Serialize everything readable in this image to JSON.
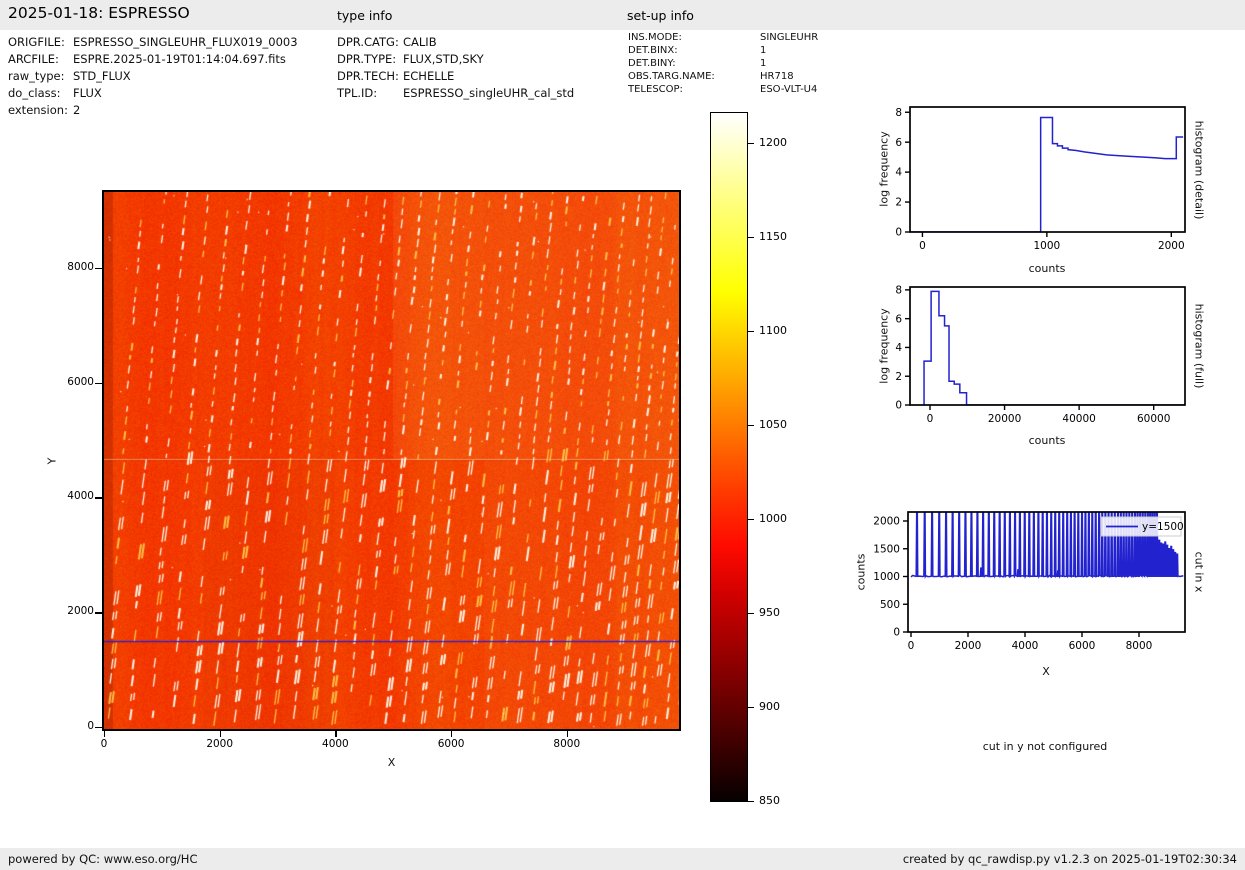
{
  "header": {
    "title": "2025-01-18: ESPRESSO",
    "type_info_label": "type info",
    "setup_info_label": "set-up info"
  },
  "file_info": {
    "rows": [
      {
        "label": "ORIGFILE:",
        "value": "ESPRESSO_SINGLEUHR_FLUX019_0003"
      },
      {
        "label": "ARCFILE:",
        "value": "ESPRE.2025-01-19T01:14:04.697.fits"
      },
      {
        "label": "raw_type:",
        "value": "STD_FLUX"
      },
      {
        "label": "do_class:",
        "value": "FLUX"
      },
      {
        "label": "extension:",
        "value": "2"
      }
    ]
  },
  "type_info": {
    "rows": [
      {
        "label": "DPR.CATG:",
        "value": "CALIB"
      },
      {
        "label": "DPR.TYPE:",
        "value": "FLUX,STD,SKY"
      },
      {
        "label": "DPR.TECH:",
        "value": "ECHELLE"
      },
      {
        "label": "TPL.ID:",
        "value": "ESPRESSO_singleUHR_cal_std"
      }
    ]
  },
  "setup_info": {
    "rows": [
      {
        "label": "INS.MODE:",
        "value": "SINGLEUHR"
      },
      {
        "label": "DET.BINX:",
        "value": "1"
      },
      {
        "label": "DET.BINY:",
        "value": "1"
      },
      {
        "label": "OBS.TARG.NAME:",
        "value": "HR718"
      },
      {
        "label": "TELESCOP:",
        "value": "ESO-VLT-U4"
      }
    ]
  },
  "footer": {
    "left": "powered by QC: www.eso.org/HC",
    "right": "created by qc_rawdisp.py v1.2.3 on 2025-01-19T02:30:34"
  },
  "colors": {
    "accent_blue": "#2222cf",
    "frame_black": "#000000",
    "bar_gray": "#ececec",
    "hot_background_orange": "#f84c04"
  },
  "chart_data": [
    {
      "id": "raw_frame",
      "type": "heatmap",
      "xlabel": "X",
      "ylabel": "Y",
      "xlim": [
        0,
        9900
      ],
      "ylim": [
        0,
        9350
      ],
      "x_ticks": [
        0,
        2000,
        4000,
        6000,
        8000
      ],
      "y_ticks": [
        0,
        2000,
        4000,
        6000,
        8000
      ],
      "colormap": "hot",
      "vmin": 850,
      "vmax": 1216,
      "background_level": 1020,
      "trace_level": 1216,
      "n_order_traces": 35,
      "detector_seam_y": 4650,
      "cut_line": {
        "y": 1500,
        "color": "#2222cf"
      },
      "description": "Raw ESPRESSO echelle frame: orange noisy background near 1000 counts crossed by ~35 near-vertical dashed bright order traces, detector seam at y=4650, blue cut line at y=1500"
    },
    {
      "id": "colorbar",
      "type": "colorbar",
      "orientation": "vertical",
      "colormap": "hot",
      "vmin": 850,
      "vmax": 1216,
      "ticks": [
        1200,
        1150,
        1100,
        1050,
        1000,
        950,
        900,
        850
      ]
    },
    {
      "id": "histogram_detail",
      "type": "line",
      "right_label": "histogram (detail)",
      "xlabel": "counts",
      "ylabel": "log frequency",
      "xlim": [
        -100,
        2110
      ],
      "ylim": [
        0,
        8.35
      ],
      "x_ticks": [
        0,
        1000,
        2000
      ],
      "y_ticks": [
        0,
        2,
        4,
        6,
        8
      ],
      "line_color": "#2222cf",
      "points": [
        [
          -90,
          0
        ],
        [
          950,
          0
        ],
        [
          950,
          7.65
        ],
        [
          1045,
          7.65
        ],
        [
          1045,
          5.9
        ],
        [
          1085,
          5.9
        ],
        [
          1085,
          5.75
        ],
        [
          1125,
          5.75
        ],
        [
          1125,
          5.6
        ],
        [
          1170,
          5.6
        ],
        [
          1170,
          5.5
        ],
        [
          1230,
          5.45
        ],
        [
          1300,
          5.35
        ],
        [
          1390,
          5.25
        ],
        [
          1480,
          5.15
        ],
        [
          1570,
          5.1
        ],
        [
          1670,
          5.05
        ],
        [
          1780,
          5.0
        ],
        [
          1880,
          4.95
        ],
        [
          1950,
          4.9
        ],
        [
          2040,
          4.9
        ],
        [
          2040,
          6.35
        ],
        [
          2095,
          6.35
        ]
      ]
    },
    {
      "id": "histogram_full",
      "type": "line",
      "right_label": "histogram (full)",
      "xlabel": "counts",
      "ylabel": "log frequency",
      "xlim": [
        -5365,
        68400
      ],
      "ylim": [
        0,
        8.2
      ],
      "x_ticks": [
        0,
        20000,
        40000,
        60000
      ],
      "y_ticks": [
        0,
        2,
        4,
        6,
        8
      ],
      "line_color": "#2222cf",
      "points": [
        [
          -1600,
          0
        ],
        [
          -1600,
          3.05
        ],
        [
          300,
          3.05
        ],
        [
          300,
          7.9
        ],
        [
          2400,
          7.9
        ],
        [
          2400,
          6.2
        ],
        [
          3900,
          6.2
        ],
        [
          3900,
          5.5
        ],
        [
          5100,
          5.5
        ],
        [
          5100,
          1.65
        ],
        [
          6500,
          1.65
        ],
        [
          6500,
          1.45
        ],
        [
          8000,
          1.45
        ],
        [
          8000,
          0.85
        ],
        [
          9800,
          0.85
        ],
        [
          9800,
          0
        ],
        [
          68400,
          0
        ]
      ]
    },
    {
      "id": "cut_in_x",
      "type": "line",
      "right_label": "cut in x",
      "xlabel": "X",
      "ylabel": "counts",
      "legend": {
        "label": "y=1500",
        "color": "#2222cf",
        "position": "upper right"
      },
      "xlim": [
        -105,
        9614
      ],
      "ylim": [
        0,
        2162
      ],
      "x_ticks": [
        0,
        2000,
        4000,
        6000,
        8000
      ],
      "y_ticks": [
        0,
        500,
        1000,
        1500,
        2000
      ],
      "baseline": 1000,
      "line_color": "#2222cf",
      "spikes": [
        [
          200,
          2162
        ],
        [
          470,
          2162
        ],
        [
          730,
          2162
        ],
        [
          980,
          2162
        ],
        [
          1220,
          2162
        ],
        [
          1450,
          2162
        ],
        [
          1680,
          2162
        ],
        [
          1900,
          2162
        ],
        [
          2110,
          2162
        ],
        [
          2320,
          2162
        ],
        [
          2450,
          1150
        ],
        [
          2520,
          2162
        ],
        [
          2720,
          2162
        ],
        [
          2910,
          2162
        ],
        [
          3100,
          2162
        ],
        [
          3280,
          2162
        ],
        [
          3460,
          2162
        ],
        [
          3640,
          2162
        ],
        [
          3750,
          1120
        ],
        [
          3810,
          2162
        ],
        [
          3980,
          2162
        ],
        [
          4140,
          2162
        ],
        [
          4300,
          2162
        ],
        [
          4460,
          2162
        ],
        [
          4610,
          2162
        ],
        [
          4760,
          2162
        ],
        [
          4910,
          2162
        ],
        [
          5050,
          2162
        ],
        [
          5150,
          1100
        ],
        [
          5190,
          2162
        ],
        [
          5330,
          2162
        ],
        [
          5470,
          2162
        ],
        [
          5600,
          2162
        ],
        [
          5730,
          2162
        ],
        [
          5860,
          2162
        ],
        [
          5990,
          2162
        ],
        [
          6110,
          2162
        ],
        [
          6230,
          2162
        ],
        [
          6350,
          2162
        ],
        [
          6470,
          2162
        ],
        [
          6590,
          2162
        ],
        [
          6700,
          2162
        ],
        [
          6810,
          2162
        ],
        [
          6920,
          2162
        ],
        [
          7030,
          2162
        ],
        [
          7140,
          2162
        ],
        [
          7250,
          2162
        ],
        [
          7350,
          2162
        ],
        [
          7450,
          2162
        ],
        [
          7550,
          2162
        ],
        [
          7650,
          2162
        ],
        [
          7750,
          2162
        ],
        [
          7850,
          2162
        ],
        [
          7940,
          2162
        ],
        [
          8030,
          2162
        ],
        [
          8120,
          2162
        ],
        [
          8210,
          2162
        ],
        [
          8300,
          2162
        ],
        [
          8380,
          2162
        ],
        [
          8460,
          2162
        ],
        [
          8540,
          2162
        ],
        [
          8620,
          2162
        ],
        [
          8700,
          1650
        ],
        [
          8770,
          1600
        ],
        [
          8840,
          1580
        ],
        [
          8910,
          1620
        ],
        [
          8980,
          1560
        ],
        [
          9050,
          1500
        ],
        [
          9120,
          1540
        ],
        [
          9190,
          1480
        ],
        [
          9260,
          1430
        ],
        [
          9330,
          1400
        ]
      ]
    },
    {
      "id": "cut_in_y",
      "type": "note",
      "text": "cut in y not configured"
    }
  ]
}
